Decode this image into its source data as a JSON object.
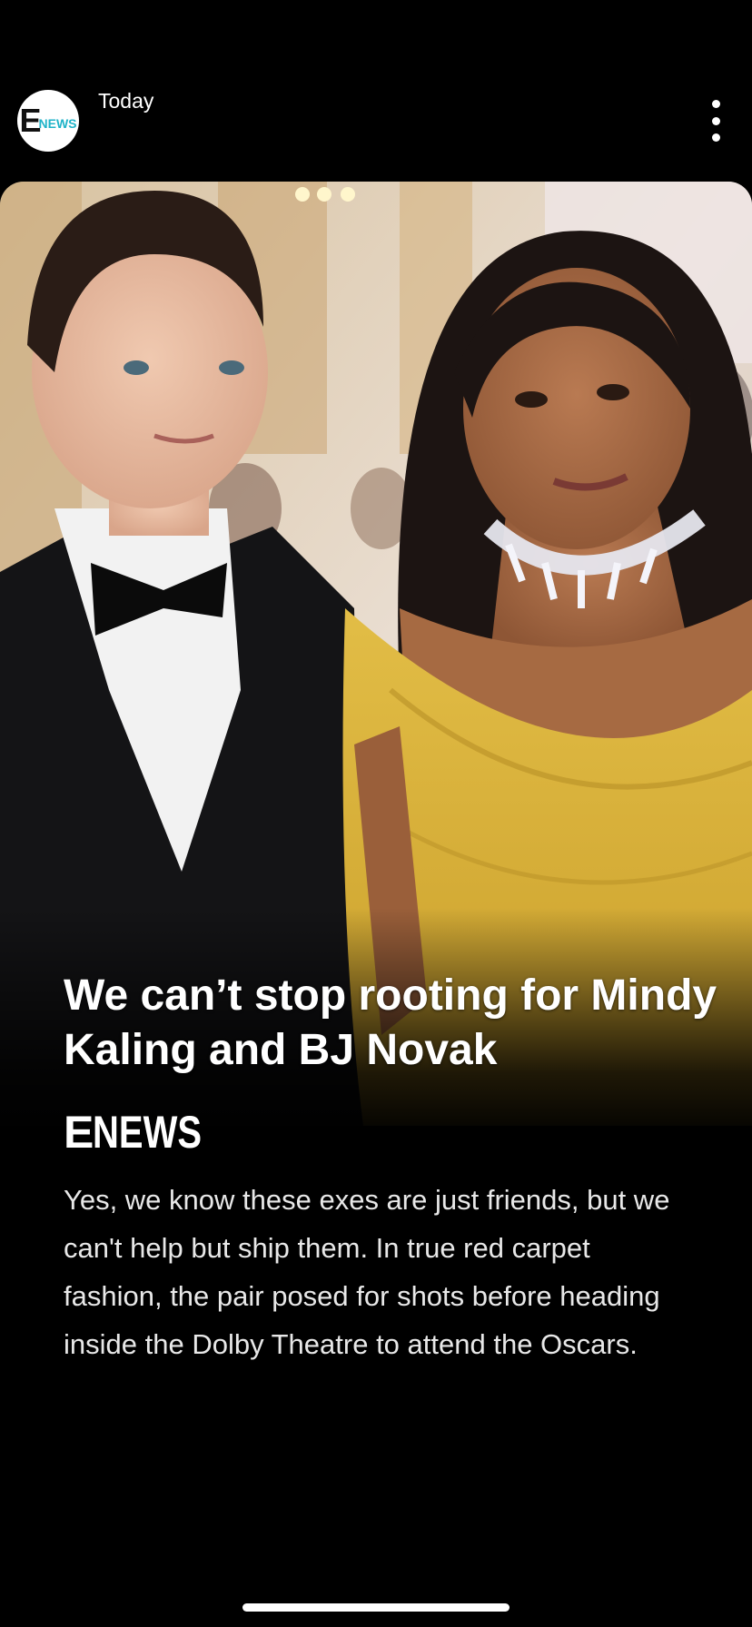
{
  "header": {
    "publisher_logo": {
      "letter": "E",
      "text": "NEWS",
      "accent": "#1fb3c8"
    },
    "day_label": "Today",
    "more_icon": "more-vertical-icon"
  },
  "story": {
    "image": "Photo of a man in a black tuxedo and a woman in a yellow off-shoulder gown with a diamond necklace",
    "headline": "We can’t stop rooting for Mindy Kaling and BJ Novak",
    "brand": {
      "letter": "E",
      "text": "NEWS"
    },
    "body": "Yes, we know these exes are just friends, but we can't help but ship them. In true red carpet fashion, the pair posed for shots before heading inside the Dolby Theatre to attend the Oscars."
  },
  "colors": {
    "background": "#000000",
    "text": "#ffffff",
    "dress": "#d9b23a"
  }
}
